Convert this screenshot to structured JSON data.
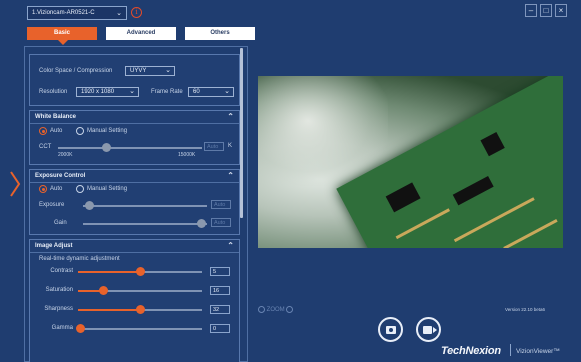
{
  "camera": {
    "selected": "1.Vizioncam-AR0521-C",
    "info_icon": "info-icon"
  },
  "window": {
    "min": "–",
    "max": "□",
    "close": "×"
  },
  "tabs": [
    {
      "label": "Basic"
    },
    {
      "label": "Advanced"
    },
    {
      "label": "Others"
    }
  ],
  "format": {
    "colorspace_label": "Color Space / Compression",
    "colorspace_value": "UYVY",
    "resolution_label": "Resolution",
    "resolution_value": "1920 x 1080",
    "framerate_label": "Frame Rate",
    "framerate_value": "60"
  },
  "white_balance": {
    "title": "White Balance",
    "auto_label": "Auto",
    "manual_label": "Manual Setting",
    "cct_label": "CCT",
    "cct_min": "2000K",
    "cct_max": "15000K",
    "cct_value": "Auto",
    "cct_unit": "K",
    "cct_level": 0.33
  },
  "exposure": {
    "title": "Exposure Control",
    "auto_label": "Auto",
    "manual_label": "Manual Setting",
    "exposure_label": "Exposure",
    "exposure_value": "Auto",
    "exposure_level": 0.05,
    "gain_label": "Gain",
    "gain_value": "Auto",
    "gain_level": 0.95
  },
  "image_adjust": {
    "title": "Image Adjust",
    "subtitle": "Real-time dynamic adjustment",
    "rows": [
      {
        "label": "Contrast",
        "value": "5",
        "level": 0.5
      },
      {
        "label": "Saturation",
        "value": "16",
        "level": 0.2
      },
      {
        "label": "Sharpness",
        "value": "32",
        "level": 0.5
      },
      {
        "label": "Gamma",
        "value": "0",
        "level": 0.02
      }
    ]
  },
  "preview": {
    "zoom_label": "ZOOM",
    "version": "Version 22.10 beta6"
  },
  "brand": {
    "name": "TechNexion",
    "product": "VizionViewer™"
  }
}
